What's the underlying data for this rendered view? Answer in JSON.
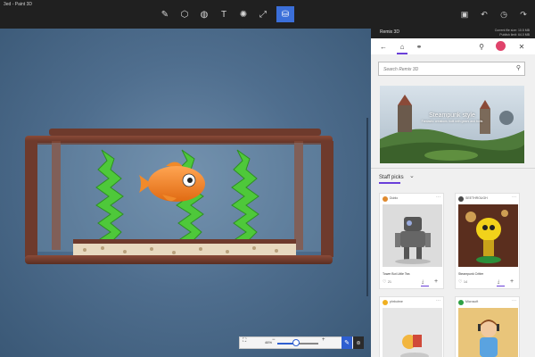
{
  "app": {
    "title": "3ed - Paint 3D"
  },
  "toolbar": {
    "tools": [
      {
        "name": "brushes-icon",
        "glyph": "✎"
      },
      {
        "name": "3d-shapes-icon",
        "glyph": "⬡"
      },
      {
        "name": "stickers-icon",
        "glyph": "◍"
      },
      {
        "name": "text-icon",
        "glyph": "T"
      },
      {
        "name": "effects-icon",
        "glyph": "✺"
      },
      {
        "name": "canvas-icon",
        "glyph": "⤢"
      },
      {
        "name": "remix3d-icon",
        "glyph": "⛁"
      }
    ],
    "active_tool": "remix3d-icon",
    "accent": "#3b6fd9"
  },
  "panel": {
    "title": "Remix 3D",
    "current_usage": "Current file size: 10.5 MB",
    "publish_limit": "Publish limit: 64.0 MB",
    "search_placeholder": "Search Remix 3D",
    "featured": {
      "title": "Steampunk style",
      "subtitle": "Fantastic creations built with gears and bolts"
    },
    "section_title": "Staff picks",
    "cards": [
      {
        "author": "Dublo",
        "name": "Tower Bot Little Tea",
        "likes": "21",
        "avatar_color": "#e08a2e"
      },
      {
        "author": "SEETHROUGH",
        "name": "Steampunk Critter",
        "likes": "14",
        "avatar_color": "#4a4a4a"
      },
      {
        "author": "phrbotme",
        "name": "",
        "likes": "",
        "avatar_color": "#f0b020"
      },
      {
        "author": "Microsoft",
        "name": "",
        "likes": "",
        "avatar_color": "#2ea043"
      }
    ],
    "accent": "#6a3fd9"
  },
  "zoom": {
    "value_label": "46%",
    "fraction": 0.46
  }
}
